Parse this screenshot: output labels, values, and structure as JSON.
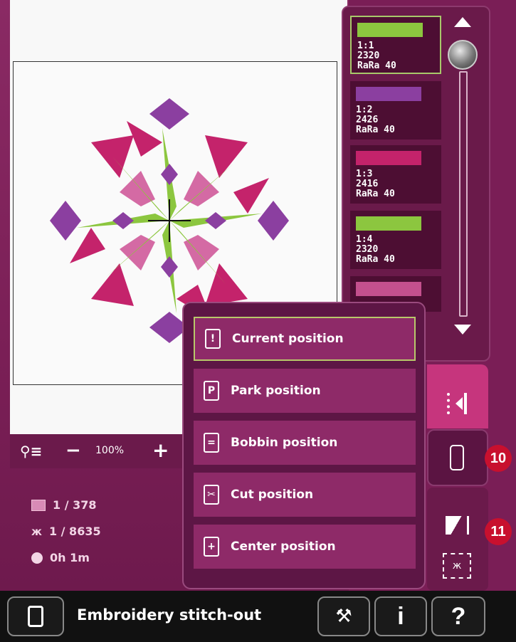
{
  "zoom": {
    "minus": "−",
    "level": "100%",
    "plus": "+"
  },
  "stats": {
    "colors": "1 / 378",
    "stitches": "1 / 8635",
    "time": "0h 1m"
  },
  "threads": [
    {
      "line1": "1:1",
      "code": "2320",
      "brand": "RaRa 40",
      "color": "#8cc63f",
      "selected": true
    },
    {
      "line1": "1:2",
      "code": "2426",
      "brand": "RaRa 40",
      "color": "#8b3fa0"
    },
    {
      "line1": "1:3",
      "code": "2416",
      "brand": "RaRa 40",
      "color": "#c4236b"
    },
    {
      "line1": "1:4",
      "code": "2320",
      "brand": "RaRa 40",
      "color": "#8cc63f"
    },
    {
      "line1": "",
      "code": "",
      "brand": "",
      "color": "#c4508e"
    }
  ],
  "menu": {
    "current": "Current position",
    "park": "Park position",
    "bobbin": "Bobbin position",
    "cut": "Cut position",
    "center": "Center position"
  },
  "menu_icons": {
    "current": "!",
    "park": "P",
    "bobbin": "=",
    "cut": "✂",
    "center": "+"
  },
  "callouts": {
    "c10": "10",
    "c11": "11"
  },
  "bottom": {
    "title": "Embroidery stitch-out",
    "info": "i",
    "help": "?"
  },
  "colors": {
    "accent": "#c6357d",
    "bg": "#7a1e56",
    "green": "#8cc63f",
    "purple": "#8b3fa0",
    "magenta": "#c4236b",
    "pink": "#c4508e"
  }
}
